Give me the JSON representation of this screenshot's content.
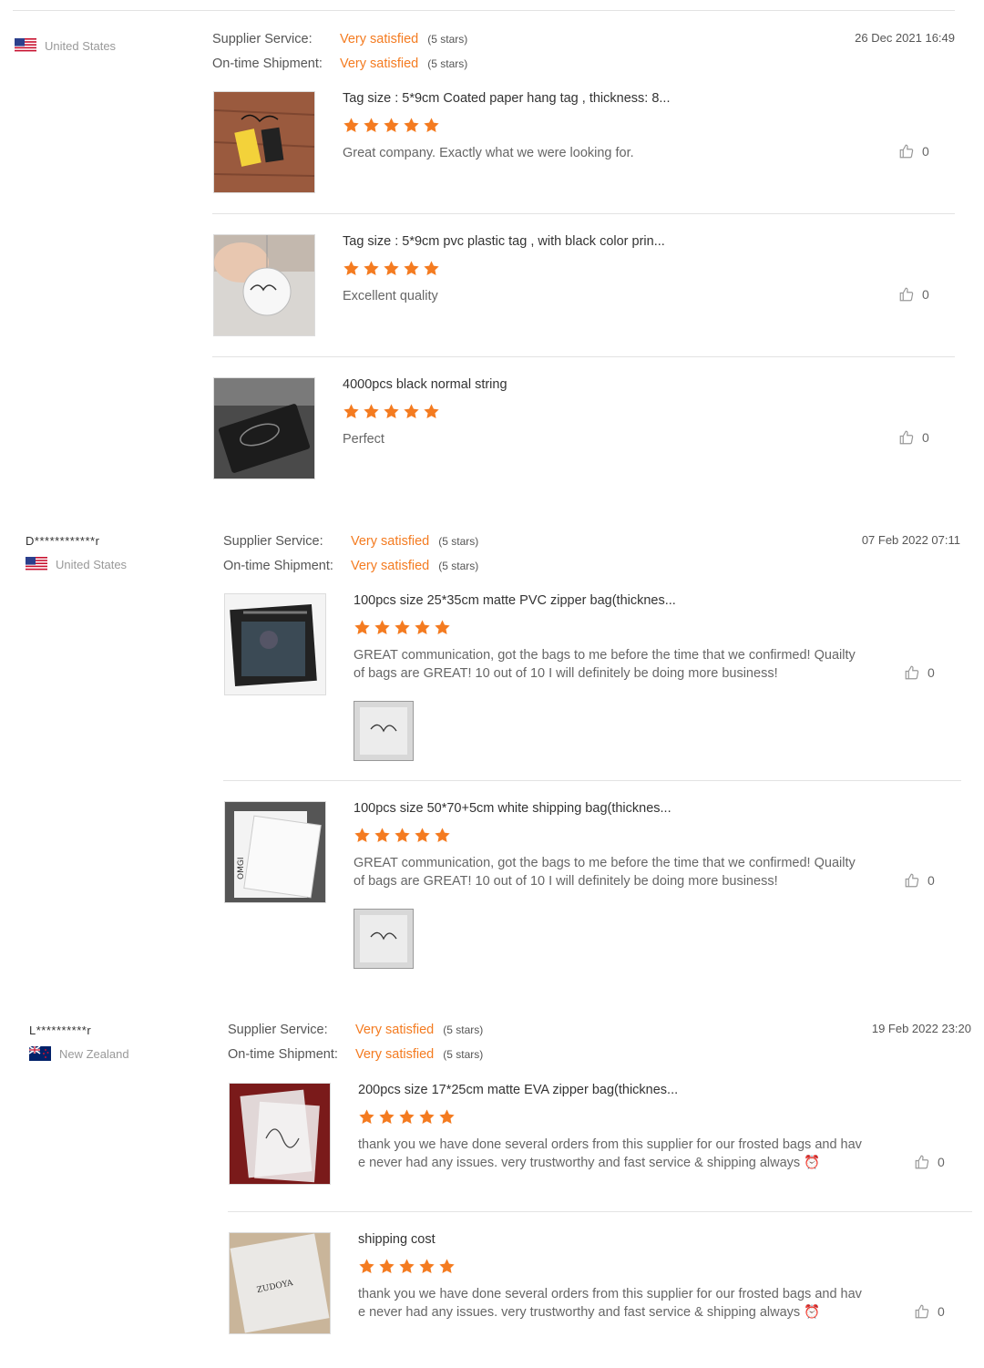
{
  "colors": {
    "accent": "#f47b20",
    "star": "#f47b20",
    "divider": "#e3e3e3"
  },
  "icons": {
    "flag_us": "us-flag-icon",
    "flag_nz": "nz-flag-icon",
    "like": "thumbs-up-icon",
    "star": "star-icon"
  },
  "reviews": [
    {
      "buyer_name": "",
      "country": "United States",
      "supplier_service_label": "Supplier Service:",
      "supplier_service_value": "Very satisfied",
      "supplier_service_stars": "(5 stars)",
      "shipment_label": "On-time Shipment:",
      "shipment_value": "Very satisfied",
      "shipment_stars": "(5 stars)",
      "date": "26 Dec 2021 16:49",
      "items": [
        {
          "title": "Tag size : 5*9cm Coated paper hang tag , thickness: 8...",
          "rating": 5,
          "text": "Great company. Exactly what we were looking for.",
          "likes": "0"
        },
        {
          "title": "Tag size : 5*9cm pvc plastic tag , with black color prin...",
          "rating": 5,
          "text": "Excellent quality",
          "likes": "0"
        },
        {
          "title": "4000pcs black normal string",
          "rating": 5,
          "text": "Perfect",
          "likes": "0"
        }
      ]
    },
    {
      "buyer_name": "D************r",
      "country": "United States",
      "supplier_service_label": "Supplier Service:",
      "supplier_service_value": "Very satisfied",
      "supplier_service_stars": "(5 stars)",
      "shipment_label": "On-time Shipment:",
      "shipment_value": "Very satisfied",
      "shipment_stars": "(5 stars)",
      "date": "07 Feb 2022 07:11",
      "items": [
        {
          "title": "100pcs size 25*35cm matte PVC zipper bag(thicknes...",
          "rating": 5,
          "text": "GREAT communication, got the bags to me before the time that we confirmed! Quailty of bags are GREAT! 10 out of 10 I will definitely be doing more business!",
          "likes": "0"
        },
        {
          "title": "100pcs size 50*70+5cm white shipping bag(thicknes...",
          "rating": 5,
          "text": "GREAT communication, got the bags to me before the time that we confirmed! Quailty of bags are GREAT! 10 out of 10 I will definitely be doing more business!",
          "likes": "0"
        }
      ]
    },
    {
      "buyer_name": "L**********r",
      "country": "New Zealand",
      "supplier_service_label": "Supplier Service:",
      "supplier_service_value": "Very satisfied",
      "supplier_service_stars": "(5 stars)",
      "shipment_label": "On-time Shipment:",
      "shipment_value": "Very satisfied",
      "shipment_stars": "(5 stars)",
      "date": "19 Feb 2022 23:20",
      "items": [
        {
          "title": "200pcs size 17*25cm matte EVA zipper bag(thicknes...",
          "rating": 5,
          "text": "thank you we have done several orders from this supplier for our frosted bags and have never had any issues. very trustworthy and fast service & shipping always ⏰",
          "likes": "0"
        },
        {
          "title": "shipping cost",
          "rating": 5,
          "text": "thank you we have done several orders from this supplier for our frosted bags and have never had any issues. very trustworthy and fast service & shipping always ⏰",
          "likes": "0"
        }
      ]
    }
  ]
}
